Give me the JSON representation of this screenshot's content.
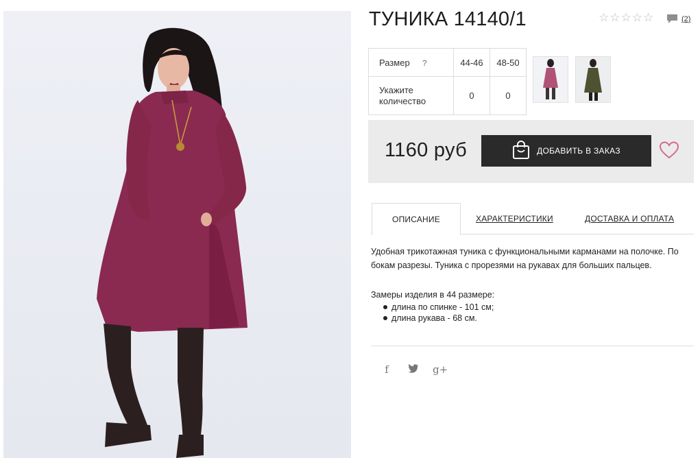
{
  "product": {
    "title": "ТУНИКА 14140/1",
    "rating_stars": 5,
    "rating_value": 0,
    "review_count": "(2)"
  },
  "sizes": {
    "size_label": "Размер",
    "help": "?",
    "quantity_label": "Укажите количество",
    "options": [
      {
        "size": "44-46",
        "qty": "0"
      },
      {
        "size": "48-50",
        "qty": "0"
      }
    ]
  },
  "thumbnails": [
    {
      "color_name": "burgundy",
      "dress_color": "#8c2c52"
    },
    {
      "color_name": "olive",
      "dress_color": "#4e5230"
    }
  ],
  "buy": {
    "price": "1160 руб",
    "add_label": "ДОБАВИТЬ В ЗАКАЗ"
  },
  "tabs": [
    {
      "label": "ОПИСАНИЕ",
      "active": true
    },
    {
      "label": "ХАРАКТЕРИСТИКИ",
      "active": false
    },
    {
      "label": "ДОСТАВКА И ОПЛАТА",
      "active": false
    }
  ],
  "description": {
    "text": "Удобная трикотажная туника с функциональными карманами на полочке. По бокам разрезы. Туника с прорезями на рукавах для больших пальцев.",
    "measures_title": "Замеры изделия в 44 размере:",
    "measures": [
      "длина по спинке - 101 см;",
      "длина рукава - 68 см."
    ]
  },
  "social": [
    {
      "name": "facebook",
      "glyph": "f"
    },
    {
      "name": "twitter",
      "glyph": "t"
    },
    {
      "name": "google-plus",
      "glyph": "g+"
    }
  ],
  "colors": {
    "dress": "#8a2a50",
    "dark_button": "#2a2a2a",
    "heart": "#d46a8c",
    "buy_bg": "#ebebeb"
  }
}
